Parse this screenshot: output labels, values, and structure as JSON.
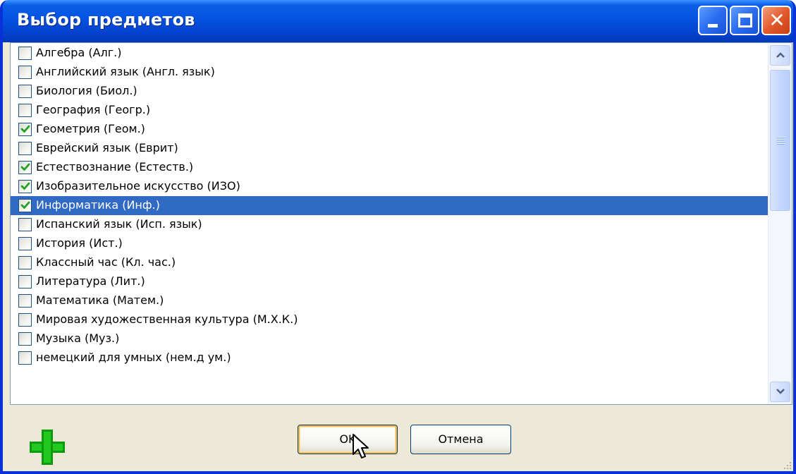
{
  "window": {
    "title": "Выбор предметов",
    "controls": {
      "minimize": "minimize-icon",
      "maximize": "maximize-icon",
      "close": "close-icon"
    }
  },
  "subjects": [
    {
      "label": "Алгебра (Алг.)",
      "checked": false,
      "selected": false
    },
    {
      "label": "Английский язык (Англ. язык)",
      "checked": false,
      "selected": false
    },
    {
      "label": "Биология (Биол.)",
      "checked": false,
      "selected": false
    },
    {
      "label": "География (Геогр.)",
      "checked": false,
      "selected": false
    },
    {
      "label": "Геометрия (Геом.)",
      "checked": true,
      "selected": false
    },
    {
      "label": "Еврейский язык (Еврит)",
      "checked": false,
      "selected": false
    },
    {
      "label": "Естествознание  (Естеств.)",
      "checked": true,
      "selected": false
    },
    {
      "label": "Изобразительное искусство (ИЗО)",
      "checked": true,
      "selected": false
    },
    {
      "label": "Информатика (Инф.)",
      "checked": true,
      "selected": true
    },
    {
      "label": "Испанский язык  (Исп. язык)",
      "checked": false,
      "selected": false
    },
    {
      "label": "История (Ист.)",
      "checked": false,
      "selected": false
    },
    {
      "label": "Классный час (Кл. час.)",
      "checked": false,
      "selected": false
    },
    {
      "label": "Литература (Лит.)",
      "checked": false,
      "selected": false
    },
    {
      "label": "Математика (Матем.)",
      "checked": false,
      "selected": false
    },
    {
      "label": "Мировая художественная культура (М.Х.К.)",
      "checked": false,
      "selected": false
    },
    {
      "label": "Музыка (Муз.)",
      "checked": false,
      "selected": false
    },
    {
      "label": "немецкий для умных (нем.д ум.)",
      "checked": false,
      "selected": false
    }
  ],
  "footer": {
    "add_icon": "plus-icon",
    "ok_label": "OK",
    "cancel_label": "Отмена"
  },
  "colors": {
    "titlebar": "#0554e3",
    "selection": "#316ac5",
    "check": "#21a121",
    "add_icon": "#0b9a0b"
  }
}
